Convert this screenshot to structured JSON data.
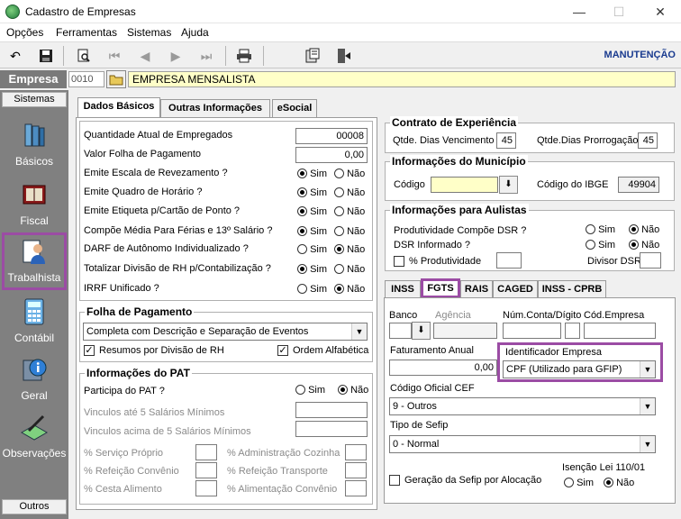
{
  "window": {
    "title": "Cadastro de Empresas",
    "min": "—",
    "max": "☐",
    "close": "✕"
  },
  "menu": {
    "items": [
      "Opções",
      "Ferramentas",
      "Sistemas",
      "Ajuda"
    ]
  },
  "toolbar": {
    "mode": "MANUTENÇÃO"
  },
  "empresa": {
    "label": "Empresa",
    "code": "0010",
    "name": "EMPRESA MENSALISTA"
  },
  "sidebar": {
    "top_header": "Sistemas",
    "bottom_header": "Outros",
    "items": [
      "Básicos",
      "Fiscal",
      "Trabalhista",
      "Contábil",
      "Geral",
      "Observações"
    ]
  },
  "tabs_left": [
    "Dados Básicos",
    "Outras Informações",
    "eSocial"
  ],
  "dados": {
    "qtd_label": "Quantidade Atual de Empregados",
    "qtd_value": "00008",
    "folha_label": "Valor Folha de Pagamento",
    "folha_value": "0,00",
    "rows": [
      {
        "label": "Emite Escala de Revezamento ?",
        "sim": "Sim",
        "nao": "Não"
      },
      {
        "label": "Emite Quadro de Horário ?",
        "sim": "Sim",
        "nao": "Não"
      },
      {
        "label": "Emite Etiqueta p/Cartão de Ponto ?",
        "sim": "Sim",
        "nao": "Não"
      },
      {
        "label": "Compõe Média Para Férias e 13º Salário ?",
        "sim": "Sim",
        "nao": "Não"
      },
      {
        "label": "DARF de Autônomo Individualizado ?",
        "sim": "Sim",
        "nao": "Não"
      },
      {
        "label": "Totalizar Divisão de RH p/Contabilização ?",
        "sim": "Sim",
        "nao": "Não"
      },
      {
        "label": "IRRF Unificado ?",
        "sim": "Sim",
        "nao": "Não"
      }
    ]
  },
  "folha": {
    "title": "Folha de Pagamento",
    "select": "Completa com Descrição e Separação de Eventos",
    "chk1": "Resumos por Divisão de RH",
    "chk2": "Ordem Alfabética"
  },
  "pat": {
    "title": "Informações do PAT",
    "participa": "Participa do PAT ?",
    "sim": "Sim",
    "nao": "Não",
    "ate": "Vinculos até 5 Salários Mínimos",
    "acima": "Vinculos acima de 5 Salários Mínimos",
    "proprio": "% Serviço Próprio",
    "refeicao": "% Refeição Convênio",
    "cesta": "% Cesta Alimento",
    "admin": "% Administração Cozinha",
    "transporte": "% Refeição Transporte",
    "alimentacao": "% Alimentação Convênio"
  },
  "contrato": {
    "title": "Contrato de Experiência",
    "venc_label": "Qtde. Dias Vencimento",
    "venc": "45",
    "prorr_label": "Qtde.Dias Prorrogação",
    "prorr": "45"
  },
  "municipio": {
    "title": "Informações do Município",
    "codigo": "Código",
    "ibge_label": "Código do IBGE",
    "ibge": "49904"
  },
  "aulistas": {
    "title": "Informações para Aulistas",
    "dsr_label": "Produtividade Compõe DSR ?",
    "inf_label": "DSR Informado ?",
    "sim": "Sim",
    "nao": "Não",
    "prod": "% Produtividade",
    "divisor": "Divisor DSR"
  },
  "tabs_right": [
    "INSS",
    "FGTS",
    "RAIS",
    "CAGED",
    "INSS - CPRB"
  ],
  "fgts": {
    "banco": "Banco",
    "agencia": "Agência",
    "conta": "Núm.Conta/Dígito",
    "codemp": "Cód.Empresa",
    "fat_label": "Faturamento Anual",
    "fat": "0,00",
    "ident_label": "Identificador Empresa",
    "ident": "CPF (Utilizado para GFIP)",
    "cef_label": "Código Oficial CEF",
    "cef": "9 - Outros",
    "sefip_label": "Tipo de Sefip",
    "sefip": "0 - Normal",
    "geracao": "Geração da Sefip por Alocação",
    "isencao": "Isenção Lei 110/01",
    "sim": "Sim",
    "nao": "Não"
  }
}
